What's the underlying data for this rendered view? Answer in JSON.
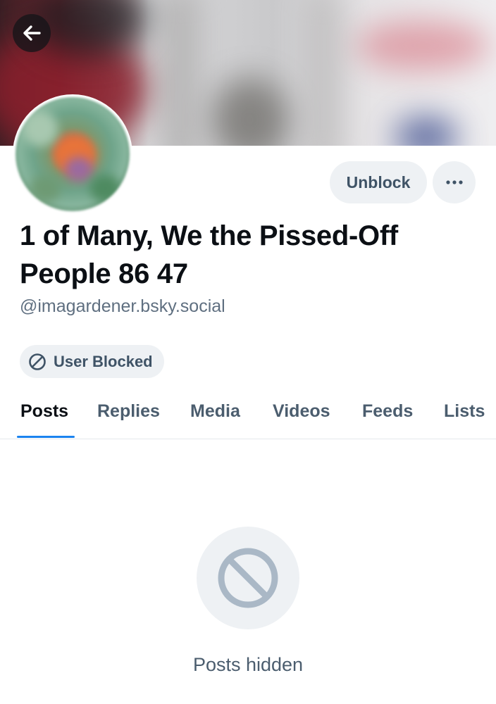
{
  "header": {
    "back_icon": "arrow-left-icon"
  },
  "profile": {
    "display_name": "1 of Many, We the Pissed-Off People 86 47",
    "handle": "@imagardener.bsky.social",
    "blocked_badge": {
      "icon": "block-icon",
      "label": "User Blocked"
    }
  },
  "actions": {
    "unblock_label": "Unblock",
    "more_icon": "ellipsis-icon"
  },
  "tabs": [
    {
      "label": "Posts",
      "active": true
    },
    {
      "label": "Replies",
      "active": false
    },
    {
      "label": "Media",
      "active": false
    },
    {
      "label": "Videos",
      "active": false
    },
    {
      "label": "Feeds",
      "active": false
    },
    {
      "label": "Lists",
      "active": false
    }
  ],
  "empty_state": {
    "icon": "block-icon",
    "message": "Posts hidden"
  },
  "colors": {
    "accent": "#1a83ef",
    "muted_text": "#5f6f80",
    "button_bg": "#eef1f4"
  }
}
